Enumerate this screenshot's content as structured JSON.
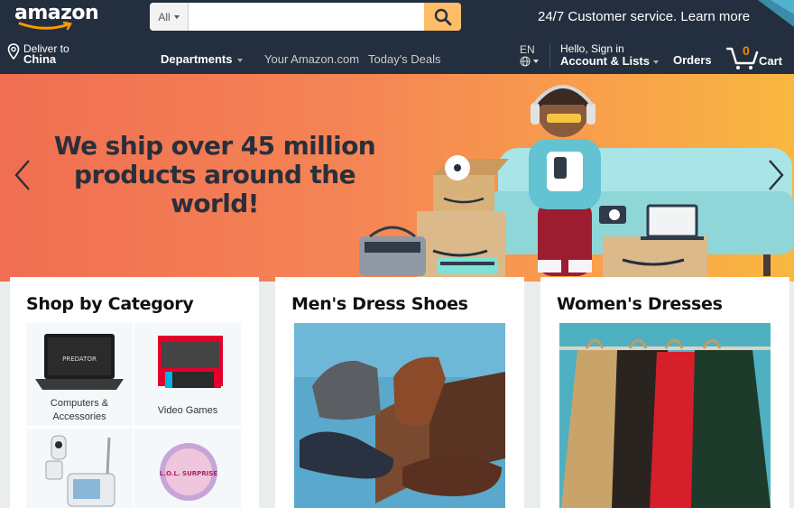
{
  "header": {
    "logo_text": "amazon",
    "search": {
      "category_label": "All",
      "placeholder": "",
      "value": ""
    },
    "promo_text": "24/7 Customer service. Learn more",
    "deliver": {
      "line1": "Deliver to",
      "line2": "China"
    },
    "nav_links": {
      "departments": "Departments",
      "your_amazon": "Your Amazon.com",
      "todays_deals": "Today's Deals"
    },
    "language": "EN",
    "account": {
      "line1": "Hello, Sign in",
      "line2": "Account & Lists"
    },
    "orders": "Orders",
    "cart": {
      "count": "0",
      "label": "Cart"
    }
  },
  "hero": {
    "headline_line1": "We ship over 45 million",
    "headline_line2": "products around the world!"
  },
  "cards": [
    {
      "title": "Shop by Category",
      "tiles": [
        {
          "label_line1": "Computers &",
          "label_line2": "Accessories",
          "image_text": "PREDATOR"
        },
        {
          "label_line1": "Video Games",
          "label_line2": ""
        },
        {
          "label_line1": "",
          "label_line2": ""
        },
        {
          "label_line1": "",
          "label_line2": "",
          "image_text": "L.O.L. SURPRISE"
        }
      ]
    },
    {
      "title": "Men's Dress Shoes"
    },
    {
      "title": "Women's Dresses"
    }
  ],
  "colors": {
    "nav_dark": "#232f3e",
    "search_button": "#febd69",
    "cart_count": "#f08804",
    "hero_start": "#f06e52",
    "hero_end": "#f9b740",
    "page_bg": "#eaeded"
  },
  "icons": [
    "search-icon",
    "location-pin-icon",
    "globe-icon",
    "cart-icon",
    "chevron-left-icon",
    "chevron-right-icon"
  ]
}
